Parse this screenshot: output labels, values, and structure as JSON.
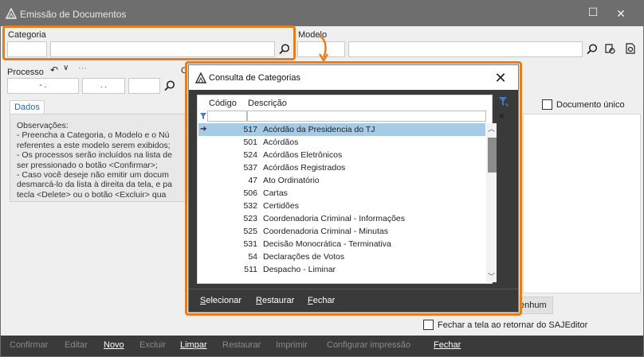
{
  "window": {
    "title": "Emissão de Documentos",
    "minimize": "—",
    "maximize": "☐",
    "close": "✕"
  },
  "form": {
    "categoria_label": "Categoria",
    "modelo_label": "Modelo",
    "processo_label": "Processo",
    "processo_parts": [
      "- .",
      ". .",
      ""
    ],
    "truncated_label": "C",
    "documento_unico_label": "Documento único",
    "nenhum_btn_partial": "enhum",
    "fechar_tela_label": "Fechar a tela ao retornar do SAJEditor"
  },
  "tabs": {
    "dados": "Dados"
  },
  "observacoes": [
    "Observações:",
    "  - Preencha a Categoria, o Modelo e o Nú",
    "referentes a este modelo serem exibidos;",
    "  - Os processos serão incluídos na lista de",
    "ser pressionado o botão <Confirmar>;",
    "  - Caso você deseje não emitir um docum",
    "desmarcá-lo da lista à direita da tela, e pa",
    "tecla <Delete> ou o botão <Excluir> qua"
  ],
  "toolbar": {
    "confirmar": "Confirmar",
    "editar": "Editar",
    "novo": "Novo",
    "excluir": "Excluir",
    "limpar": "Limpar",
    "restaurar": "Restaurar",
    "imprimir": "Imprimir",
    "configurar": "Configurar impressão",
    "fechar": "Fechar"
  },
  "dialog": {
    "title": "Consulta de Categorias",
    "columns": {
      "codigo": "Código",
      "descricao": "Descrição"
    },
    "rows": [
      {
        "code": "517",
        "desc": "Acórdão da Presidencia do TJ"
      },
      {
        "code": "501",
        "desc": "Acórdãos"
      },
      {
        "code": "524",
        "desc": "Acórdãos Eletrônicos"
      },
      {
        "code": "537",
        "desc": "Acórdãos Registrados"
      },
      {
        "code": "47",
        "desc": "Ato Ordinatório"
      },
      {
        "code": "506",
        "desc": "Cartas"
      },
      {
        "code": "532",
        "desc": "Certidões"
      },
      {
        "code": "523",
        "desc": "Coordenadoria Criminal - Informações"
      },
      {
        "code": "525",
        "desc": "Coordenadoria Criminal - Minutas"
      },
      {
        "code": "531",
        "desc": "Decisão Monocrática - Terminativa"
      },
      {
        "code": "54",
        "desc": "Declarações de Votos"
      },
      {
        "code": "511",
        "desc": "Despacho - Liminar"
      }
    ],
    "selected_index": 0,
    "footer": {
      "selecionar": "Selecionar",
      "restaurar": "Restaurar",
      "fechar": "Fechar"
    }
  },
  "colors": {
    "highlight": "#e87d1e",
    "selected_row": "#a6cbe8",
    "dark_bar": "#3a3a3a"
  }
}
